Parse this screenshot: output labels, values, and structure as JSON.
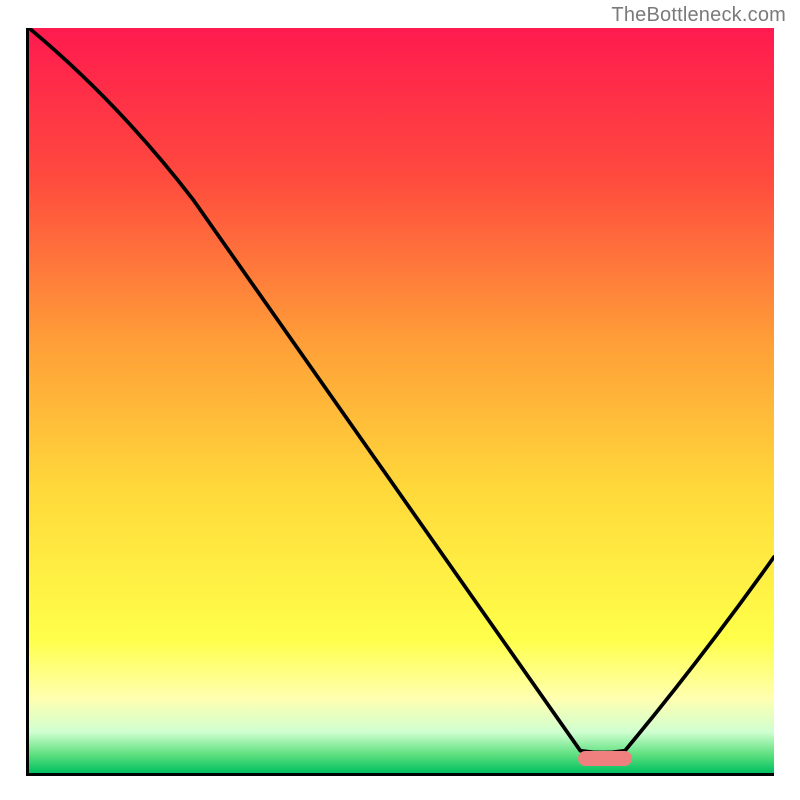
{
  "watermark": "TheBottleneck.com",
  "chart_data": {
    "type": "line",
    "title": "",
    "xlabel": "",
    "ylabel": "",
    "xlim": [
      0,
      100
    ],
    "ylim": [
      0,
      100
    ],
    "x": [
      0,
      22,
      74,
      80,
      100
    ],
    "values": [
      100,
      77,
      3,
      3,
      29
    ],
    "gradient_stops": [
      {
        "offset": 0.0,
        "color": "#ff1a4f"
      },
      {
        "offset": 0.2,
        "color": "#ff4a3e"
      },
      {
        "offset": 0.42,
        "color": "#ff9e38"
      },
      {
        "offset": 0.62,
        "color": "#ffd93a"
      },
      {
        "offset": 0.82,
        "color": "#ffff4a"
      },
      {
        "offset": 0.9,
        "color": "#ffffb0"
      },
      {
        "offset": 0.945,
        "color": "#d0ffd0"
      },
      {
        "offset": 0.975,
        "color": "#60e080"
      },
      {
        "offset": 1.0,
        "color": "#00c060"
      }
    ],
    "marker": {
      "x_center": 77,
      "y": 2.3
    }
  }
}
